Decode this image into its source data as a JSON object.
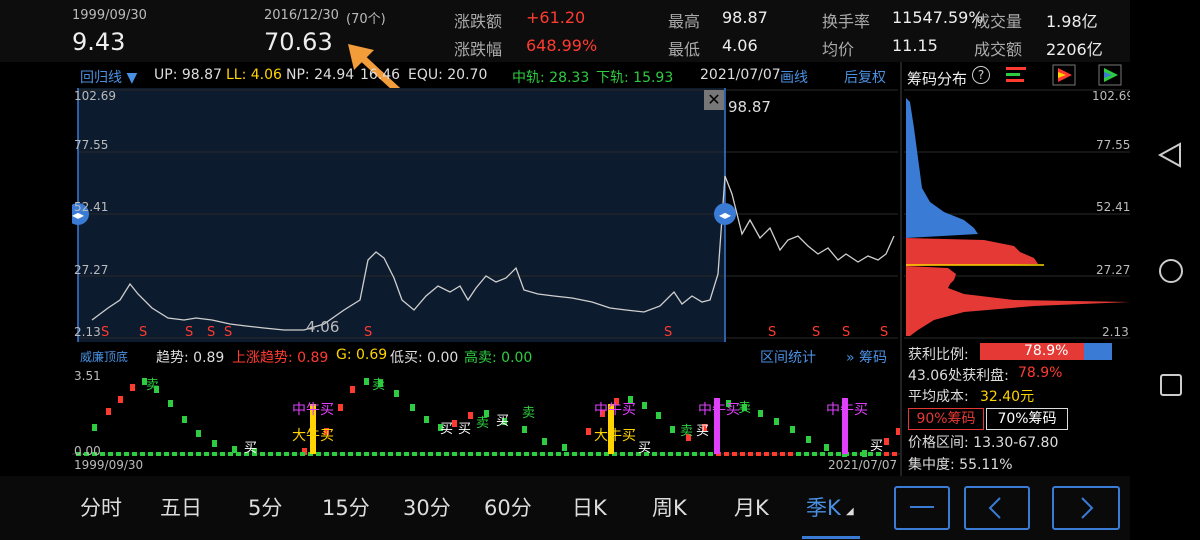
{
  "header": {
    "start_date": "1999/09/30",
    "start_price": "9.43",
    "end_date": "2016/12/30",
    "count": "(70个)",
    "end_price": "70.63",
    "change_amount_label": "涨跌额",
    "change_amount": "+61.20",
    "change_pct_label": "涨跌幅",
    "change_pct": "648.99%",
    "high_label": "最高",
    "high": "98.87",
    "low_label": "最低",
    "low": "4.06",
    "turnover_label": "换手率",
    "turnover": "11547.59%",
    "volume_label": "成交量",
    "volume": "1.98亿",
    "avg_label": "均价",
    "avg": "11.15",
    "amount_label": "成交额",
    "amount": "2206亿"
  },
  "indicator_bar": {
    "name": "回归线",
    "up": "UP: 98.87",
    "ll": "LL: 4.06",
    "np": "NP: 24.94",
    "np2": "16.46",
    "equ": "EQU: 20.70",
    "mid": "中轨: 28.33",
    "low": "下轨: 15.93",
    "date": "2021/07/07",
    "link": "画线",
    "restore": "后复权"
  },
  "main_chart": {
    "y_labels": [
      "102.69",
      "77.55",
      "52.41",
      "27.27",
      "2.13"
    ],
    "peak_label": "98.87",
    "low_label": "4.06",
    "s_markers": [
      "S",
      "S",
      "S",
      "S",
      "S",
      "S",
      "S",
      "S",
      "S",
      "S",
      "S"
    ]
  },
  "sub_indicator": {
    "name": "威廉顶底",
    "trend": "趋势: 0.89",
    "up_trend": "上涨趋势: 0.89",
    "g": "G: 0.69",
    "low_buy": "低买: 0.00",
    "high_sell": "高卖: 0.00",
    "range_stats": "区间统计",
    "chips_link": "筹码",
    "y_top": "3.51",
    "y_bottom": "0.00",
    "date_start": "1999/09/30",
    "date_end": "2021/07/07",
    "signals": {
      "buy": "买",
      "sell": "卖",
      "bull_mid": "中牛买",
      "bull_big": "大牛买"
    }
  },
  "chip_panel": {
    "title": "筹码分布",
    "help": "?",
    "y_labels": [
      "102.69",
      "77.55",
      "52.41",
      "27.27",
      "2.13"
    ],
    "profit_ratio_label": "获利比例:",
    "profit_ratio": "78.9%",
    "profit_line_price": "43.06处获利盘:",
    "profit_line_value": "78.9%",
    "avg_cost_label": "平均成本:",
    "avg_cost": "32.40元",
    "chip90": "90%筹码",
    "chip70": "70%筹码",
    "price_range": "价格区间: 13.30-67.80",
    "concentration": "集中度: 55.11%"
  },
  "periods": [
    "分时",
    "五日",
    "5分",
    "15分",
    "30分",
    "60分",
    "日K",
    "周K",
    "月K",
    "季K"
  ],
  "active_period": "季K",
  "colors": {
    "accent": "#4a90e2",
    "up": "#ff3b30",
    "down": "#2ecc40",
    "magenta": "#e040fb",
    "yellow": "#ffd400",
    "arrow": "#f39c3a"
  }
}
